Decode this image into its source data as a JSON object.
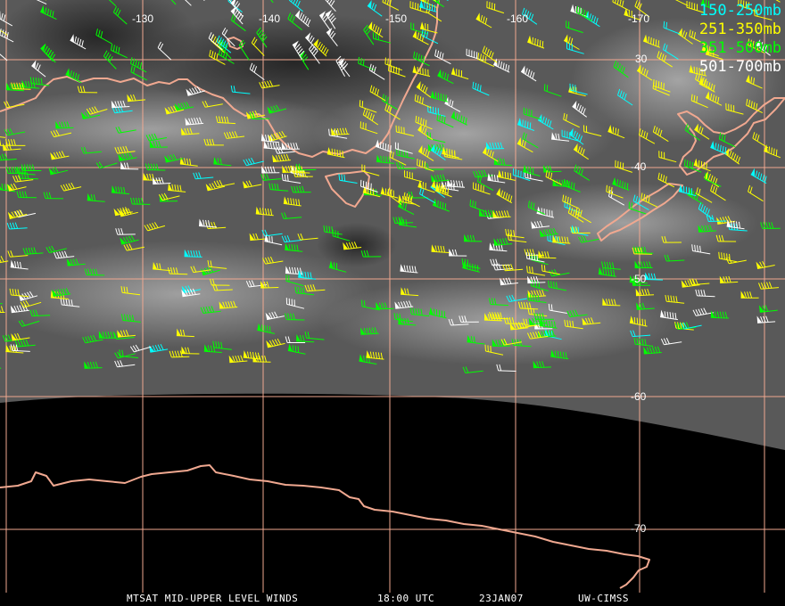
{
  "legend": {
    "items": [
      {
        "label": "150-250mb",
        "color": "#00ffff"
      },
      {
        "label": "251-350mb",
        "color": "#ffff00"
      },
      {
        "label": "351-500mb",
        "color": "#00ff00"
      },
      {
        "label": "501-700mb",
        "color": "#ffffff"
      }
    ]
  },
  "lon_labels": [
    "-130",
    "-140",
    "-150",
    "-160",
    "-170"
  ],
  "lat_labels": [
    "30",
    "-40",
    "-50",
    "-60",
    "-70"
  ],
  "footer": {
    "product": "MTSAT MID-UPPER LEVEL WINDS",
    "time": "18:00 UTC",
    "date": "23JAN07",
    "source": "UW-CIMSS"
  },
  "colors": {
    "grid": "#f0a890",
    "coast": "#f0a890",
    "background": "#000000"
  }
}
